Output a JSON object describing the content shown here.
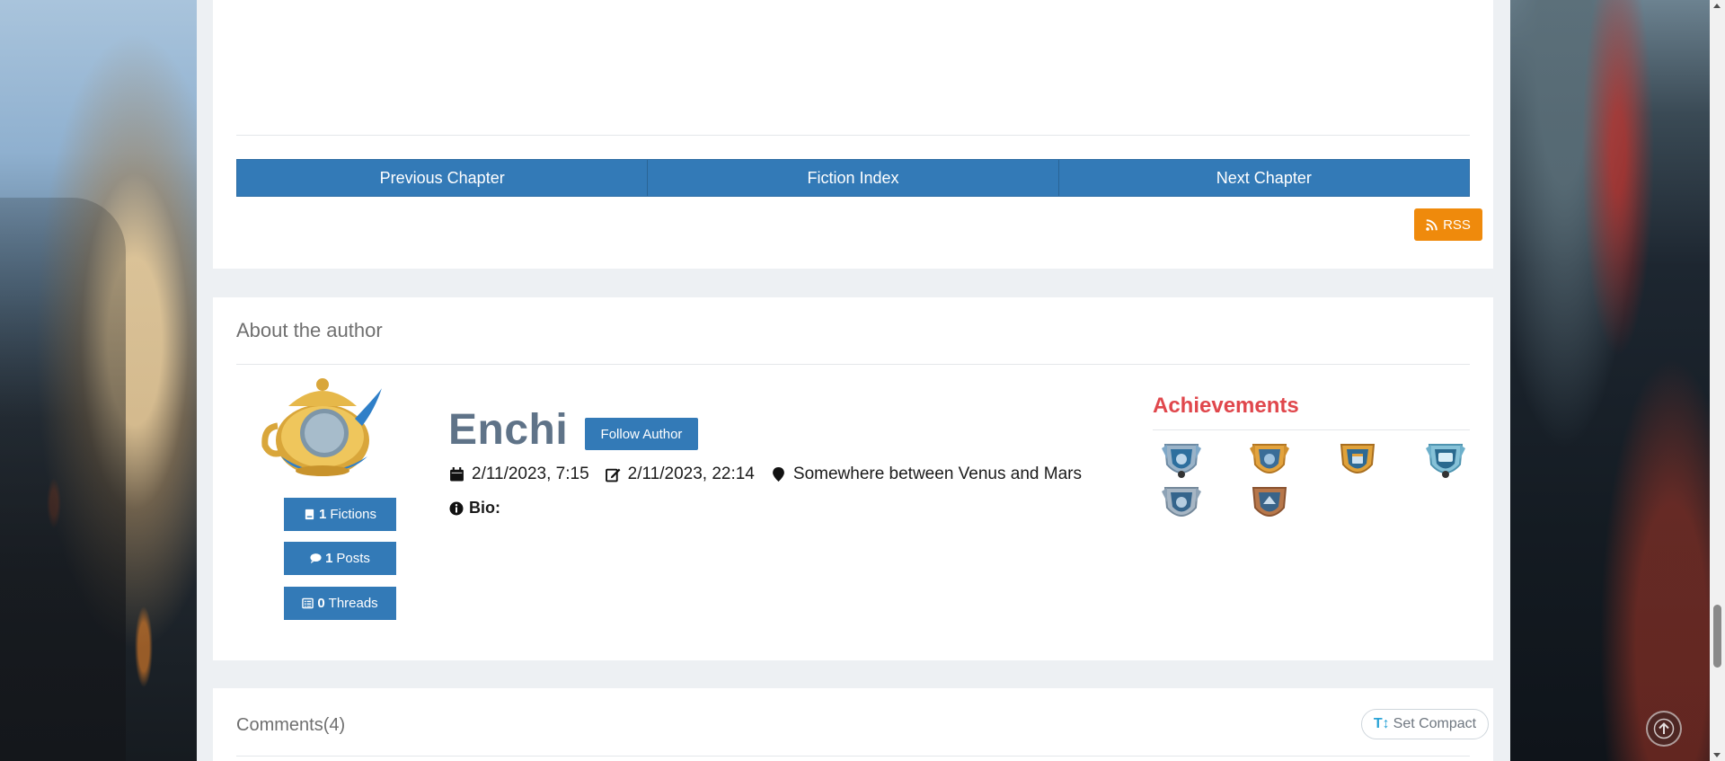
{
  "chapter_nav": {
    "previous_label": "Previous Chapter",
    "index_label": "Fiction Index",
    "next_label": "Next Chapter",
    "rss_label": "RSS"
  },
  "about": {
    "section_title": "About the author",
    "author_name": "Enchi",
    "follow_label": "Follow Author",
    "stats": {
      "fictions_count": "1",
      "fictions_label": "Fictions",
      "posts_count": "1",
      "posts_label": "Posts",
      "threads_count": "0",
      "threads_label": "Threads"
    },
    "joined": "2/11/2023, 7:15",
    "last_active": "2/11/2023, 22:14",
    "location": "Somewhere between Venus and Mars",
    "bio_label": "Bio:",
    "achievements_title": "Achievements",
    "achievement_icons": [
      "badge-blue-silver",
      "badge-gold-blue",
      "badge-gold-calendar",
      "badge-teal-chat",
      "badge-silver-blue",
      "badge-bronze-blue"
    ]
  },
  "comments": {
    "title": "Comments(4)",
    "compact_label": "Set Compact"
  },
  "colors": {
    "primary_blue": "#337ab7",
    "rss_orange": "#ef8a0c",
    "achievement_red": "#e0474c",
    "author_name": "#5f7388"
  }
}
